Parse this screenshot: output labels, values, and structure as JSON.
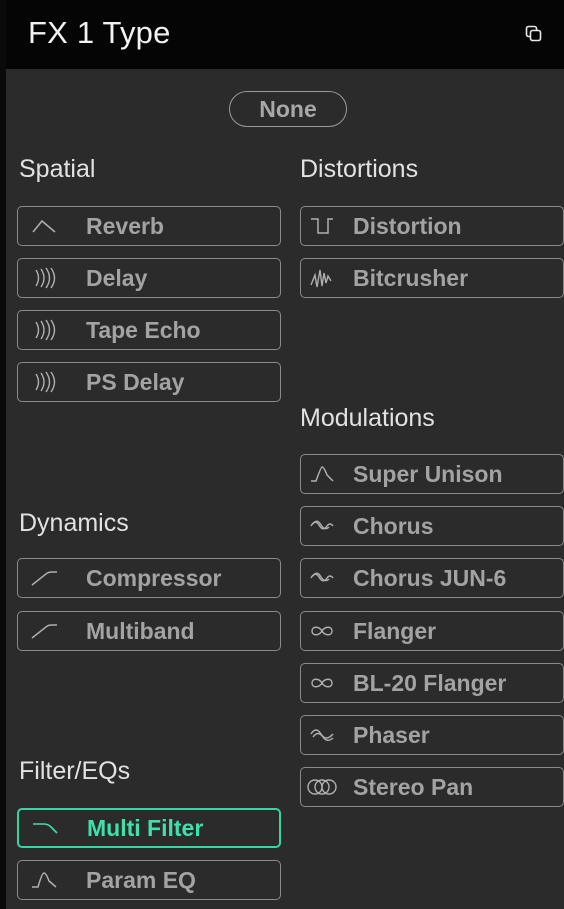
{
  "header": {
    "title": "FX 1 Type",
    "copy_icon": "copy-icon"
  },
  "none_label": "None",
  "sections": {
    "spatial": "Spatial",
    "distortions": "Distortions",
    "modulations": "Modulations",
    "dynamics": "Dynamics",
    "filters": "Filter/EQs"
  },
  "effects": {
    "spatial": [
      {
        "label": "Reverb",
        "icon": "reverb-icon"
      },
      {
        "label": "Delay",
        "icon": "delay-icon"
      },
      {
        "label": "Tape Echo",
        "icon": "delay-icon"
      },
      {
        "label": "PS Delay",
        "icon": "delay-icon"
      }
    ],
    "distortions": [
      {
        "label": "Distortion",
        "icon": "distortion-icon"
      },
      {
        "label": "Bitcrusher",
        "icon": "bitcrusher-icon"
      }
    ],
    "modulations": [
      {
        "label": "Super Unison",
        "icon": "unison-icon"
      },
      {
        "label": "Chorus",
        "icon": "chorus-icon"
      },
      {
        "label": "Chorus JUN-6",
        "icon": "chorus-icon"
      },
      {
        "label": "Flanger",
        "icon": "flanger-icon"
      },
      {
        "label": "BL-20 Flanger",
        "icon": "flanger-icon"
      },
      {
        "label": "Phaser",
        "icon": "phaser-icon"
      },
      {
        "label": "Stereo Pan",
        "icon": "stereo-pan-icon"
      }
    ],
    "dynamics": [
      {
        "label": "Compressor",
        "icon": "compressor-icon"
      },
      {
        "label": "Multiband",
        "icon": "compressor-icon"
      }
    ],
    "filters": [
      {
        "label": "Multi Filter",
        "icon": "multi-filter-icon",
        "selected": true
      },
      {
        "label": "Param EQ",
        "icon": "param-eq-icon"
      }
    ]
  },
  "colors": {
    "accent": "#34d6a3",
    "border": "#8a8a8a",
    "panel": "#2b2b2b",
    "header": "#050505"
  }
}
